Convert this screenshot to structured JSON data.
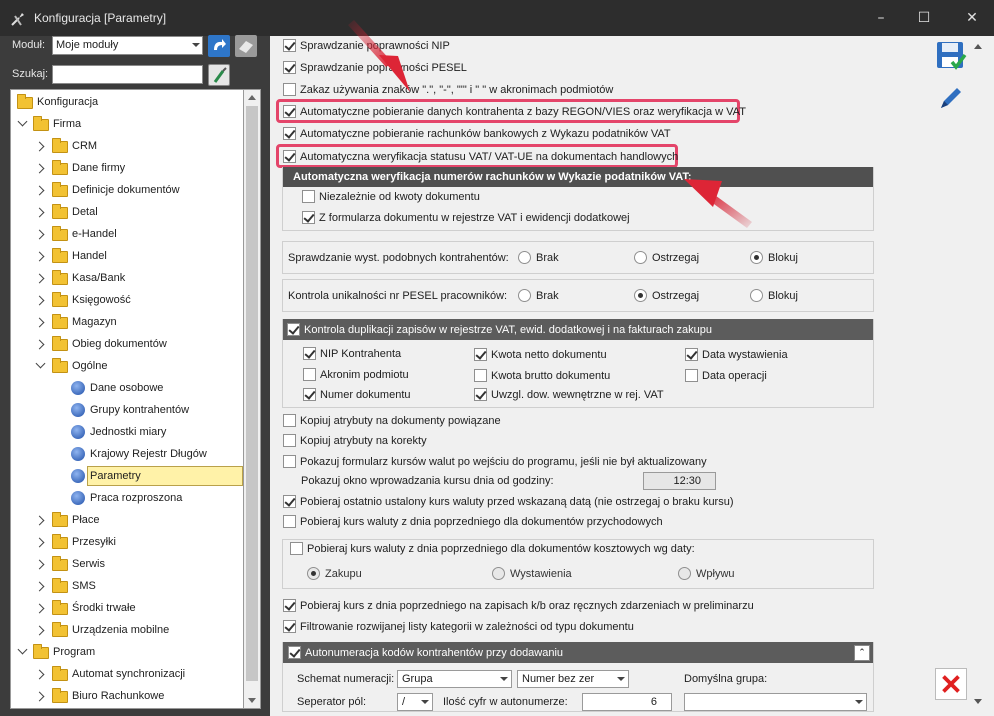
{
  "window": {
    "title": "Konfiguracja [Parametry]",
    "minimize": "–",
    "maximize": "☐",
    "close": "✕"
  },
  "filters": {
    "module_label": "Moduł:",
    "module_value": "Moje moduły",
    "search_label": "Szukaj:",
    "search_value": ""
  },
  "tree": [
    {
      "label": "Konfiguracja"
    },
    {
      "label": "Firma"
    },
    {
      "label": "CRM"
    },
    {
      "label": "Dane firmy"
    },
    {
      "label": "Definicje dokumentów"
    },
    {
      "label": "Detal"
    },
    {
      "label": "e-Handel"
    },
    {
      "label": "Handel"
    },
    {
      "label": "Kasa/Bank"
    },
    {
      "label": "Księgowość"
    },
    {
      "label": "Magazyn"
    },
    {
      "label": "Obieg dokumentów"
    },
    {
      "label": "Ogólne"
    },
    {
      "label": "Dane osobowe"
    },
    {
      "label": "Grupy kontrahentów"
    },
    {
      "label": "Jednostki miary"
    },
    {
      "label": "Krajowy Rejestr Długów"
    },
    {
      "label": "Parametry"
    },
    {
      "label": "Praca rozproszona"
    },
    {
      "label": "Płace"
    },
    {
      "label": "Przesyłki"
    },
    {
      "label": "Serwis"
    },
    {
      "label": "SMS"
    },
    {
      "label": "Środki trwałe"
    },
    {
      "label": "Urządzenia mobilne"
    },
    {
      "label": "Program"
    },
    {
      "label": "Automat synchronizacji"
    },
    {
      "label": "Biuro Rachunkowe"
    }
  ],
  "params": {
    "nip": "Sprawdzanie poprawności NIP",
    "pesel": "Sprawdzanie poprawności PESEL",
    "zakaz": "Zakaz używania znaków \".\", \"-\", \"'\" i \" \" w akronimach podmiotów",
    "regon": "Automatyczne pobieranie danych kontrahenta z bazy REGON/VIES oraz weryfikacja w VAT",
    "bank": "Automatyczne pobieranie rachunków bankowych z Wykazu podatników VAT",
    "vatue": "Automatyczna weryfikacja statusu VAT/ VAT-UE na dokumentach handlowych",
    "wykaz_head": "Automatyczna weryfikacja numerów rachunków w Wykazie podatników VAT:",
    "niezaleznie": "Niezależnie od kwoty dokumentu",
    "zformularza": "Z formularza dokumentu w rejestrze VAT i ewidencji dodatkowej",
    "podobni": "Sprawdzanie wyst. podobnych kontrahentów:",
    "pesel_unik": "Kontrola unikalności nr PESEL pracowników:",
    "opt_brak": "Brak",
    "opt_ostrzegaj": "Ostrzegaj",
    "opt_blokuj": "Blokuj",
    "duplikacja": "Kontrola duplikacji zapisów w rejestrze VAT, ewid. dodatkowej i na fakturach zakupu",
    "dup_nip": "NIP Kontrahenta",
    "dup_netto": "Kwota netto dokumentu",
    "dup_data_wyst": "Data wystawienia",
    "dup_akronim": "Akronim podmiotu",
    "dup_brutto": "Kwota brutto dokumentu",
    "dup_data_op": "Data operacji",
    "dup_numer": "Numer dokumentu",
    "dup_uwzgl": "Uwzgl. dow. wewnętrzne w rej. VAT",
    "kopiuj_atr": "Kopiuj atrybuty na dokumenty powiązane",
    "kopiuj_kor": "Kopiuj atrybuty na korekty",
    "kursy_form": "Pokazuj formularz kursów walut po wejściu do programu, jeśli nie był aktualizowany",
    "kursy_okno": "Pokazuj okno wprowadzania kursu dnia od godziny:",
    "kursy_godz": "12:30",
    "kurs_ustalony": "Pobieraj ostatnio ustalony kurs waluty przed wskazaną datą (nie ostrzegaj o braku kursu)",
    "kurs_przych": "Pobieraj kurs waluty z dnia poprzedniego dla dokumentów przychodowych",
    "kurs_koszt": "Pobieraj kurs waluty z dnia poprzedniego dla dokumentów kosztowych wg daty:",
    "opt_zakupu": "Zakupu",
    "opt_wystawienia": "Wystawienia",
    "opt_wplywu": "Wpływu",
    "kurs_kb": "Pobieraj kurs z dnia poprzedniego na zapisach k/b oraz ręcznych zdarzeniach w preliminarzu",
    "filtr_kat": "Filtrowanie rozwijanej listy kategorii w zależności od typu dokumentu",
    "autonum": "Autonumeracja kodów kontrahentów przy dodawaniu",
    "schemat_label": "Schemat numeracji:",
    "schemat_value": "Grupa",
    "numer_value": "Numer bez zer",
    "domyslna_label": "Domyślna grupa:",
    "separator_label": "Seperator pól:",
    "separator_value": "/",
    "cyfry_label": "Ilość cyfr w autonumerze:",
    "cyfry_value": "6"
  },
  "colors": {
    "highlight": "#e4456a",
    "arrow": "#d8283a",
    "selected": "#fff2a8"
  }
}
